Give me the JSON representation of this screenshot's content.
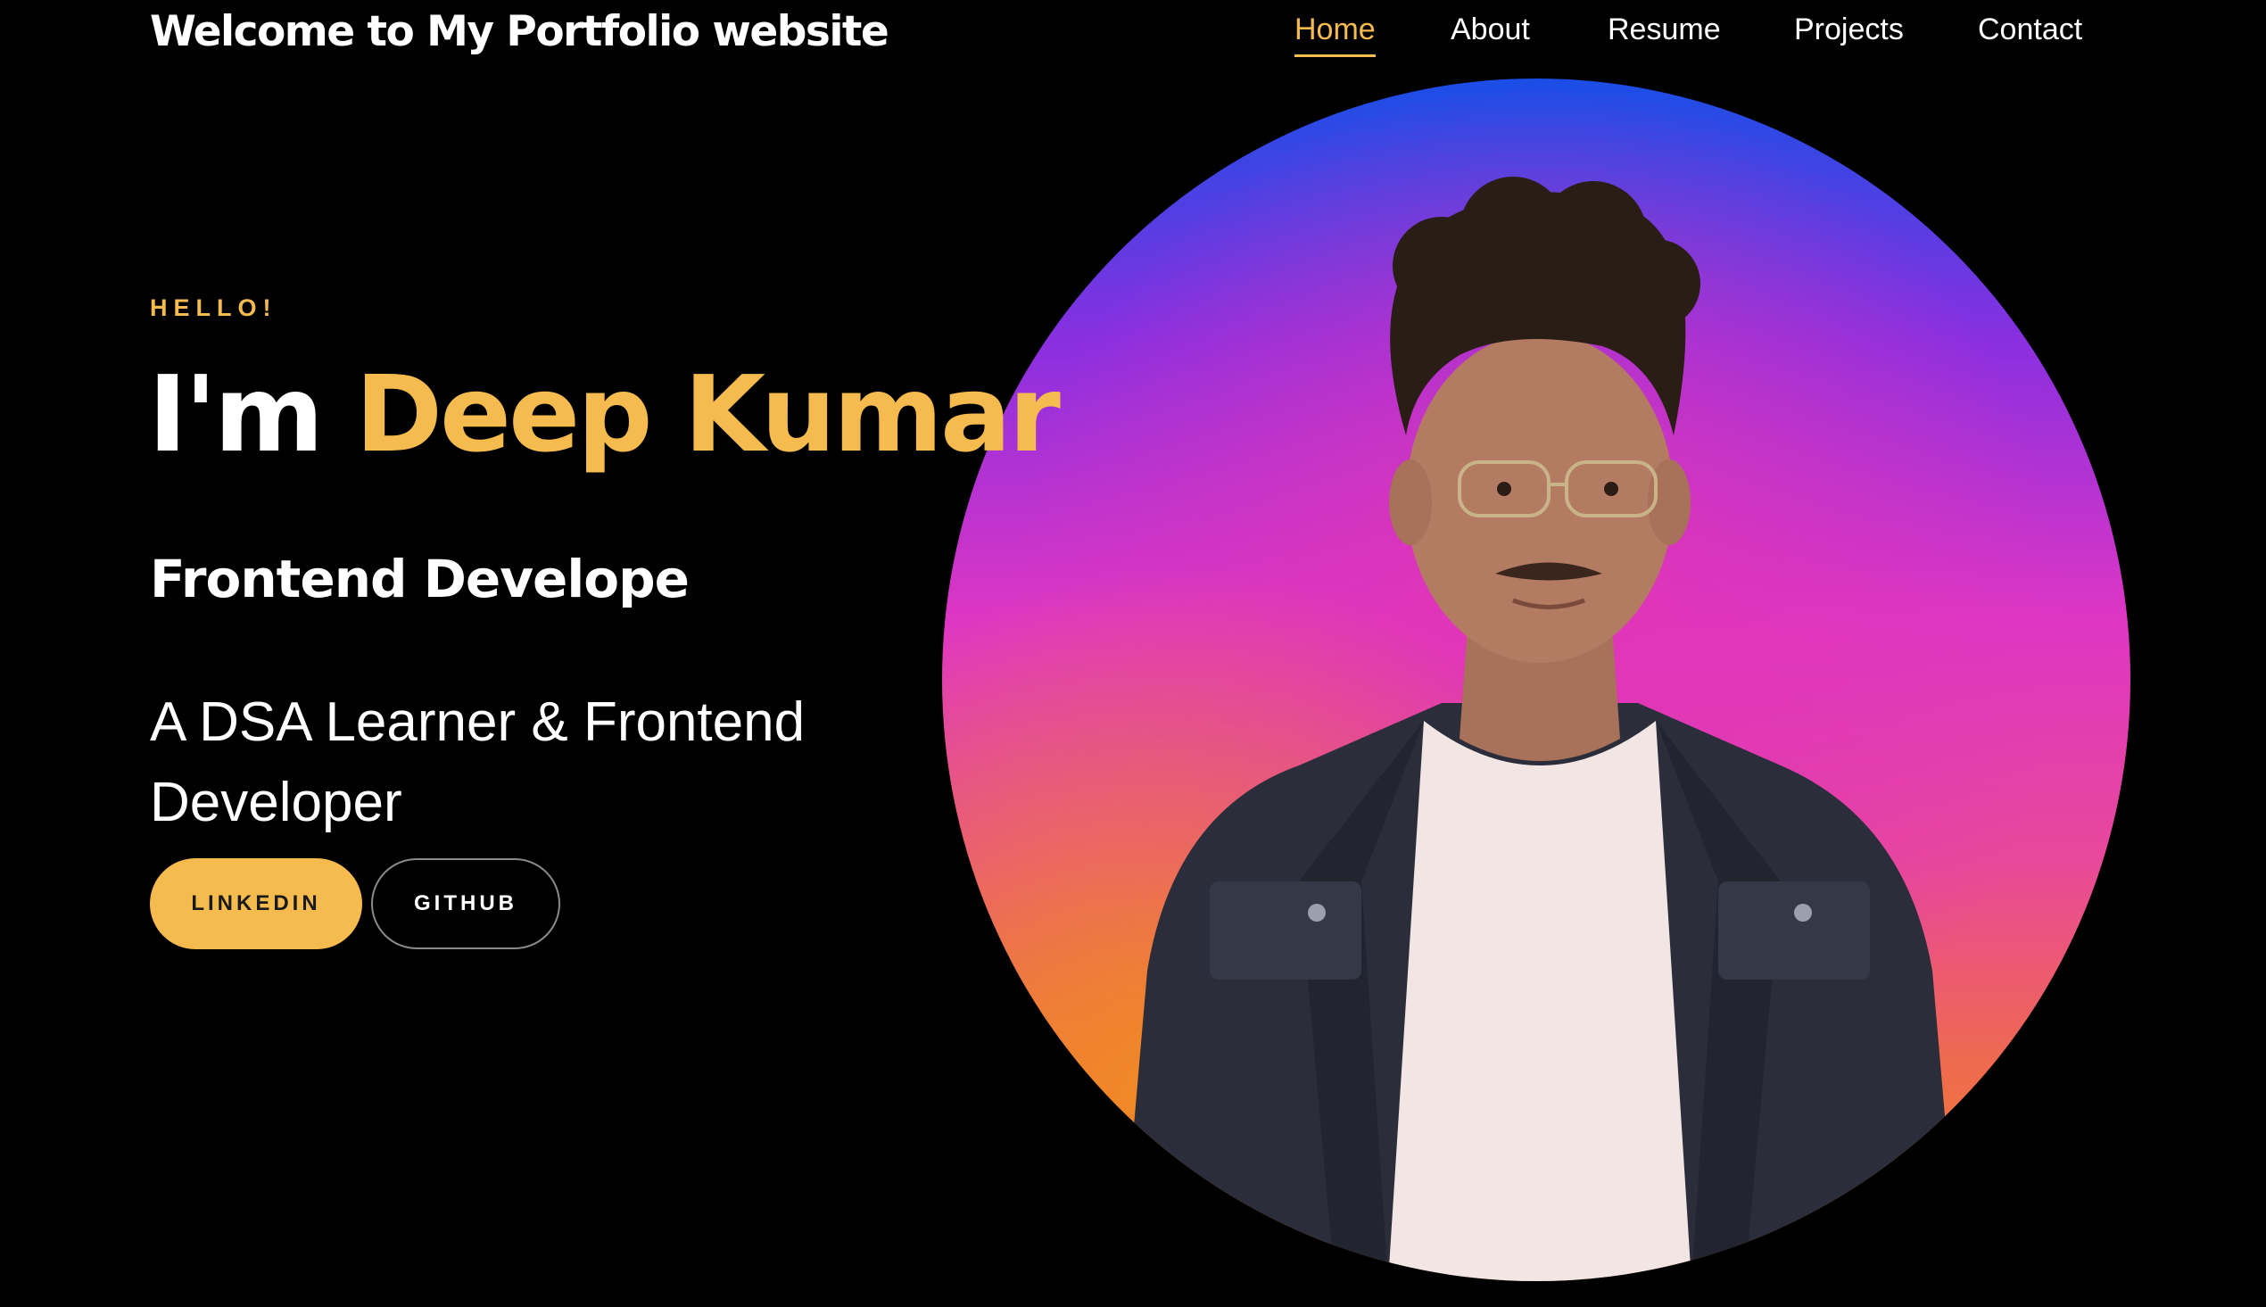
{
  "header": {
    "brand": "Welcome to My Portfolio website"
  },
  "nav": {
    "items": [
      {
        "label": "Home",
        "active": true
      },
      {
        "label": "About",
        "active": false
      },
      {
        "label": "Resume",
        "active": false
      },
      {
        "label": "Projects",
        "active": false
      },
      {
        "label": "Contact",
        "active": false
      }
    ]
  },
  "hero": {
    "greeting": "HELLO!",
    "headline_prefix": "I'm",
    "name": "Deep Kumar",
    "role": "Frontend Develope",
    "tagline": "A DSA Learner & Frontend Developer",
    "buttons": {
      "linkedin": "LINKEDIN",
      "github": "GITHUB"
    },
    "portrait_icon": "profile-photo"
  },
  "colors": {
    "accent": "#f5bb4e",
    "background": "#000000",
    "text": "#ffffff",
    "portrait_gradient_top": "#1a4ee6",
    "portrait_gradient_mid": "#de36c4",
    "portrait_gradient_bottom": "#f08a24"
  }
}
